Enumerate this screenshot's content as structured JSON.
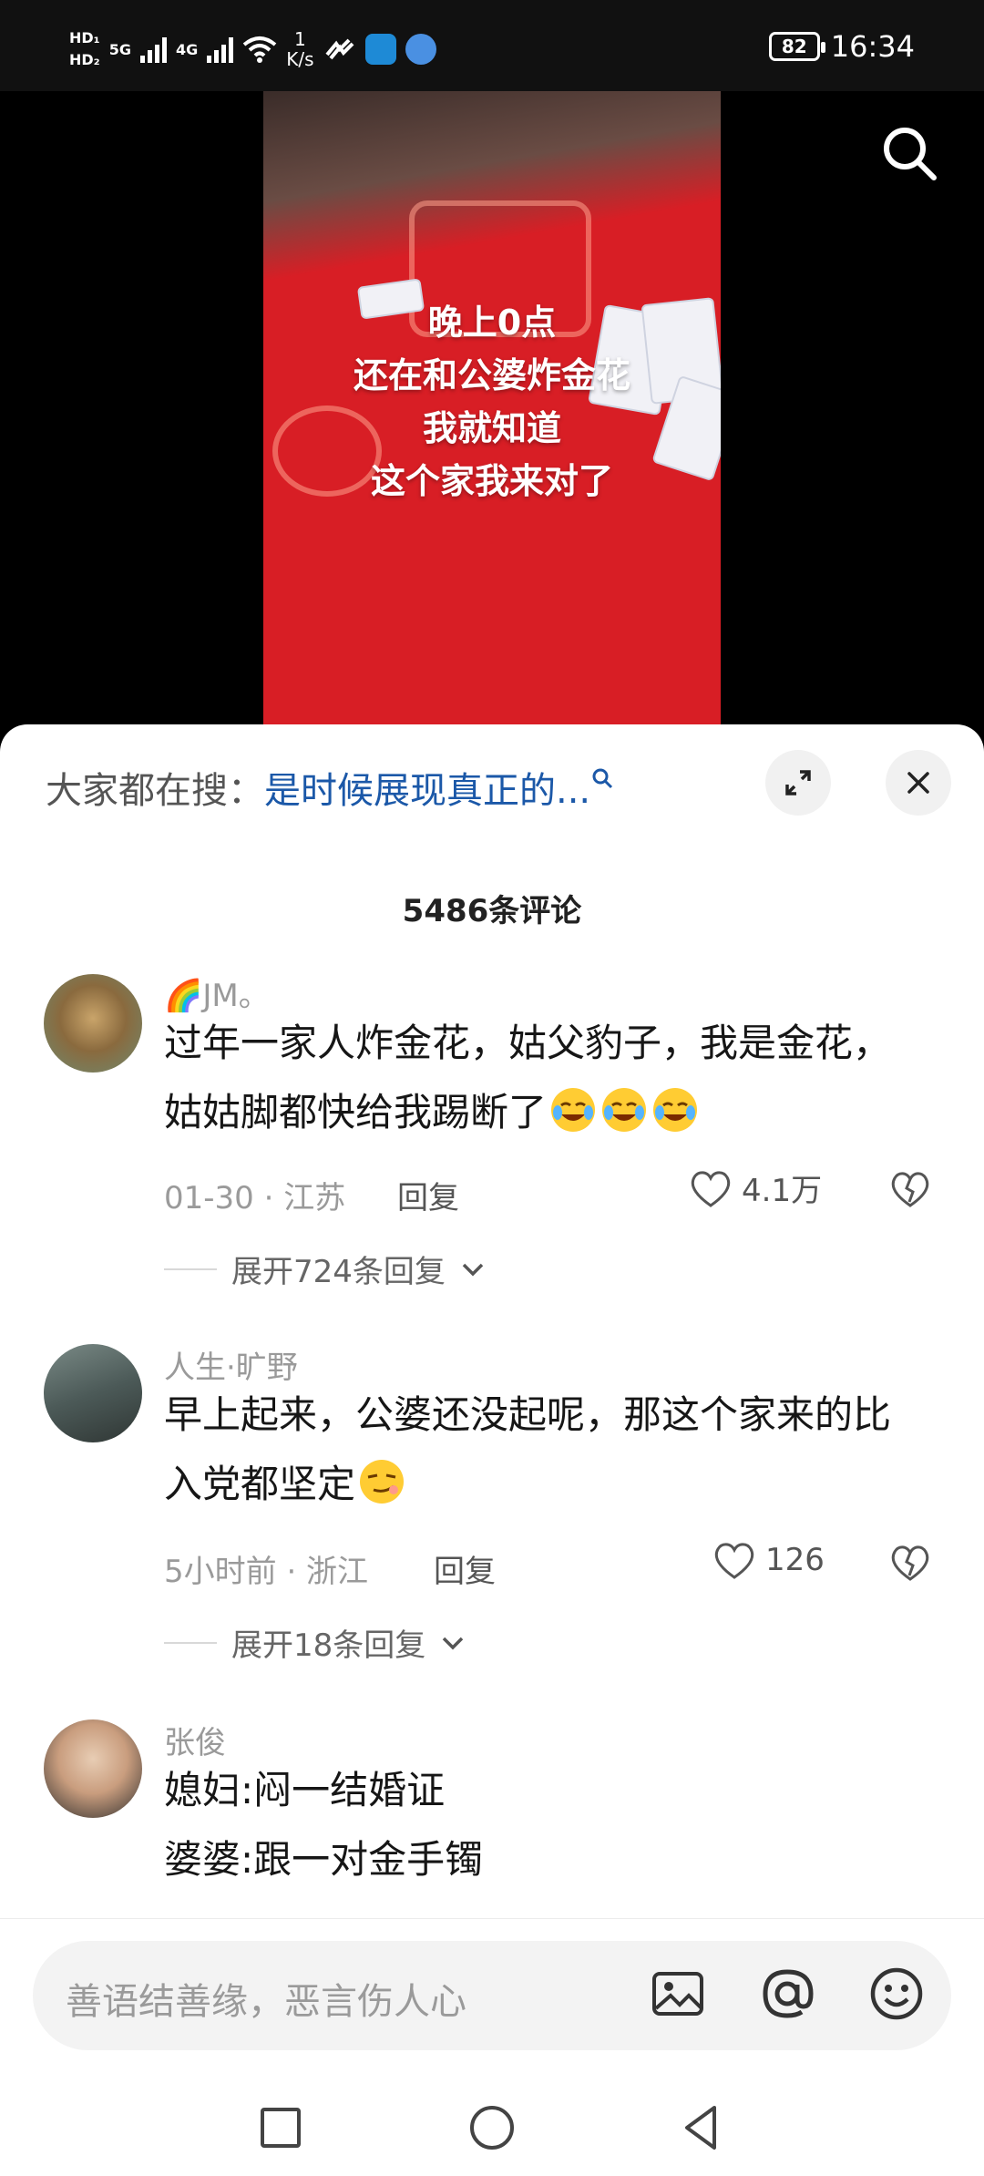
{
  "status_bar": {
    "hd1": "HD₁",
    "hd2": "HD₂",
    "net1": "5G",
    "net2": "4G",
    "speed_value": "1",
    "speed_unit": "K/s",
    "battery": "82",
    "time": "16:34"
  },
  "video": {
    "caption_lines": [
      "晚上0点",
      "还在和公婆炸金花",
      "我就知道",
      "这个家我来对了"
    ]
  },
  "hot_search": {
    "label": "大家都在搜：",
    "query": "是时候展现真正的..."
  },
  "comments_count": "5486条评论",
  "comments": [
    {
      "name": "🌈JM。",
      "text": "过年一家人炸金花，姑父豹子，我是金花，姑姑脚都快给我踢断了",
      "emoji": [
        "tears-of-joy-emoji",
        "tears-of-joy-emoji",
        "tears-of-joy-emoji"
      ],
      "meta": "01-30 · 江苏",
      "reply": "回复",
      "likes": "4.1万",
      "expand": "展开724条回复"
    },
    {
      "name": "人生·旷野",
      "text": "早上起来，公婆还没起呢，那这个家来的比入党都坚定",
      "emoji": [
        "smirk-emoji"
      ],
      "meta": "5小时前 · 浙江",
      "reply": "回复",
      "likes": "126",
      "expand": "展开18条回复"
    },
    {
      "name": "张俊",
      "text_lines": [
        "媳妇:闷一结婚证",
        "婆婆:跟一对金手镯"
      ]
    }
  ],
  "input": {
    "placeholder": "善语结善缘，恶言伤人心"
  },
  "colors": {
    "accent_link": "#1b58a8",
    "video_bg": "#d81e25"
  }
}
